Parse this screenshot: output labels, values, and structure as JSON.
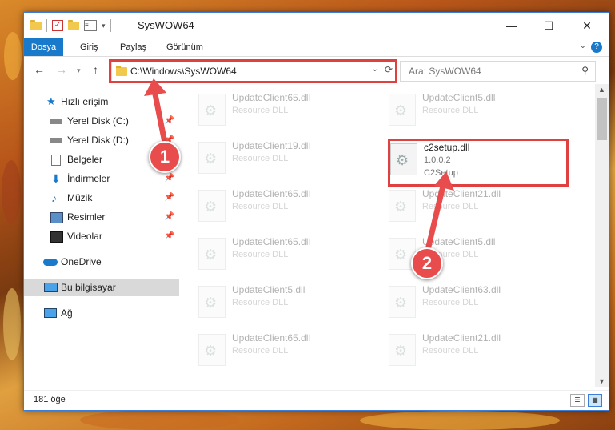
{
  "window": {
    "title": "SysWOW64",
    "controls": {
      "minimize": "—",
      "maximize": "☐",
      "close": "✕"
    }
  },
  "ribbon": {
    "tabs": [
      "Dosya",
      "Giriş",
      "Paylaş",
      "Görünüm"
    ],
    "help": "?"
  },
  "nav": {
    "address": "C:\\Windows\\SysWOW64",
    "search_placeholder": "Ara: SysWOW64"
  },
  "sidebar": {
    "items": [
      {
        "label": "Hızlı erişim",
        "icon": "star-icon"
      },
      {
        "label": "Yerel Disk (C:)",
        "icon": "drive-icon",
        "pinned": true
      },
      {
        "label": "Yerel Disk (D:)",
        "icon": "drive-icon",
        "pinned": true
      },
      {
        "label": "Belgeler",
        "icon": "documents-icon",
        "pinned": true
      },
      {
        "label": "İndirmeler",
        "icon": "download-icon",
        "pinned": true
      },
      {
        "label": "Müzik",
        "icon": "music-icon",
        "pinned": true
      },
      {
        "label": "Resimler",
        "icon": "pictures-icon",
        "pinned": true
      },
      {
        "label": "Videolar",
        "icon": "videos-icon",
        "pinned": true
      },
      {
        "label": "OneDrive",
        "icon": "cloud-icon"
      },
      {
        "label": "Bu bilgisayar",
        "icon": "computer-icon",
        "selected": true
      },
      {
        "label": "Ağ",
        "icon": "network-icon"
      }
    ]
  },
  "files": {
    "left": [
      {
        "name": "UpdateClient65.dll",
        "type": "Resource DLL"
      },
      {
        "name": "UpdateClient19.dll",
        "type": "Resource DLL"
      },
      {
        "name": "UpdateClient65.dll",
        "type": "Resource DLL"
      },
      {
        "name": "UpdateClient65.dll",
        "type": "Resource DLL"
      },
      {
        "name": "UpdateClient5.dll",
        "type": "Resource DLL"
      },
      {
        "name": "UpdateClient65.dll",
        "type": "Resource DLL"
      }
    ],
    "right": [
      {
        "name": "UpdateClient5.dll",
        "type": "Resource DLL"
      },
      {
        "name": "UpdateClient21.dll",
        "type": "Resource DLL"
      },
      {
        "name": "UpdateClient5.dll",
        "type": "Resource DLL"
      },
      {
        "name": "UpdateClient63.dll",
        "type": "Resource DLL"
      },
      {
        "name": "UpdateClient21.dll",
        "type": "Resource DLL"
      }
    ],
    "highlighted": {
      "name": "c2setup.dll",
      "version": "1.0.0.2",
      "description": "C2Setup"
    }
  },
  "status": {
    "item_count": "181 öğe"
  },
  "annotations": {
    "badge1": "1",
    "badge2": "2",
    "color": "#e84c4c"
  }
}
